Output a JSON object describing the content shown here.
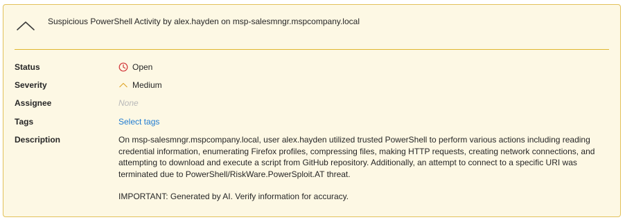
{
  "alert": {
    "title": "Suspicious PowerShell Activity by alex.hayden on msp-salesmngr.mspcompany.local",
    "accent_color": "#e0b62f",
    "background_color": "#fdf8e4"
  },
  "fields": {
    "status": {
      "label": "Status",
      "value": "Open",
      "icon": "clock-icon",
      "icon_color": "#d13438"
    },
    "severity": {
      "label": "Severity",
      "value": "Medium",
      "icon": "chevron-up-icon",
      "icon_color": "#e0a82e"
    },
    "assignee": {
      "label": "Assignee",
      "value": "None"
    },
    "tags": {
      "label": "Tags",
      "value": "Select tags",
      "link_color": "#1f7bd1"
    },
    "description": {
      "label": "Description",
      "text": "On msp-salesmngr.mspcompany.local, user alex.hayden utilized trusted PowerShell to perform various actions including reading credential information, enumerating Firefox profiles, compressing files, making HTTP requests, creating network connections, and attempting to download and execute a script from GitHub repository. Additionally, an attempt to connect to a specific URI was terminated due to PowerShell/RiskWare.PowerSploit.AT threat.",
      "note": "IMPORTANT: Generated by AI. Verify information for accuracy."
    }
  }
}
